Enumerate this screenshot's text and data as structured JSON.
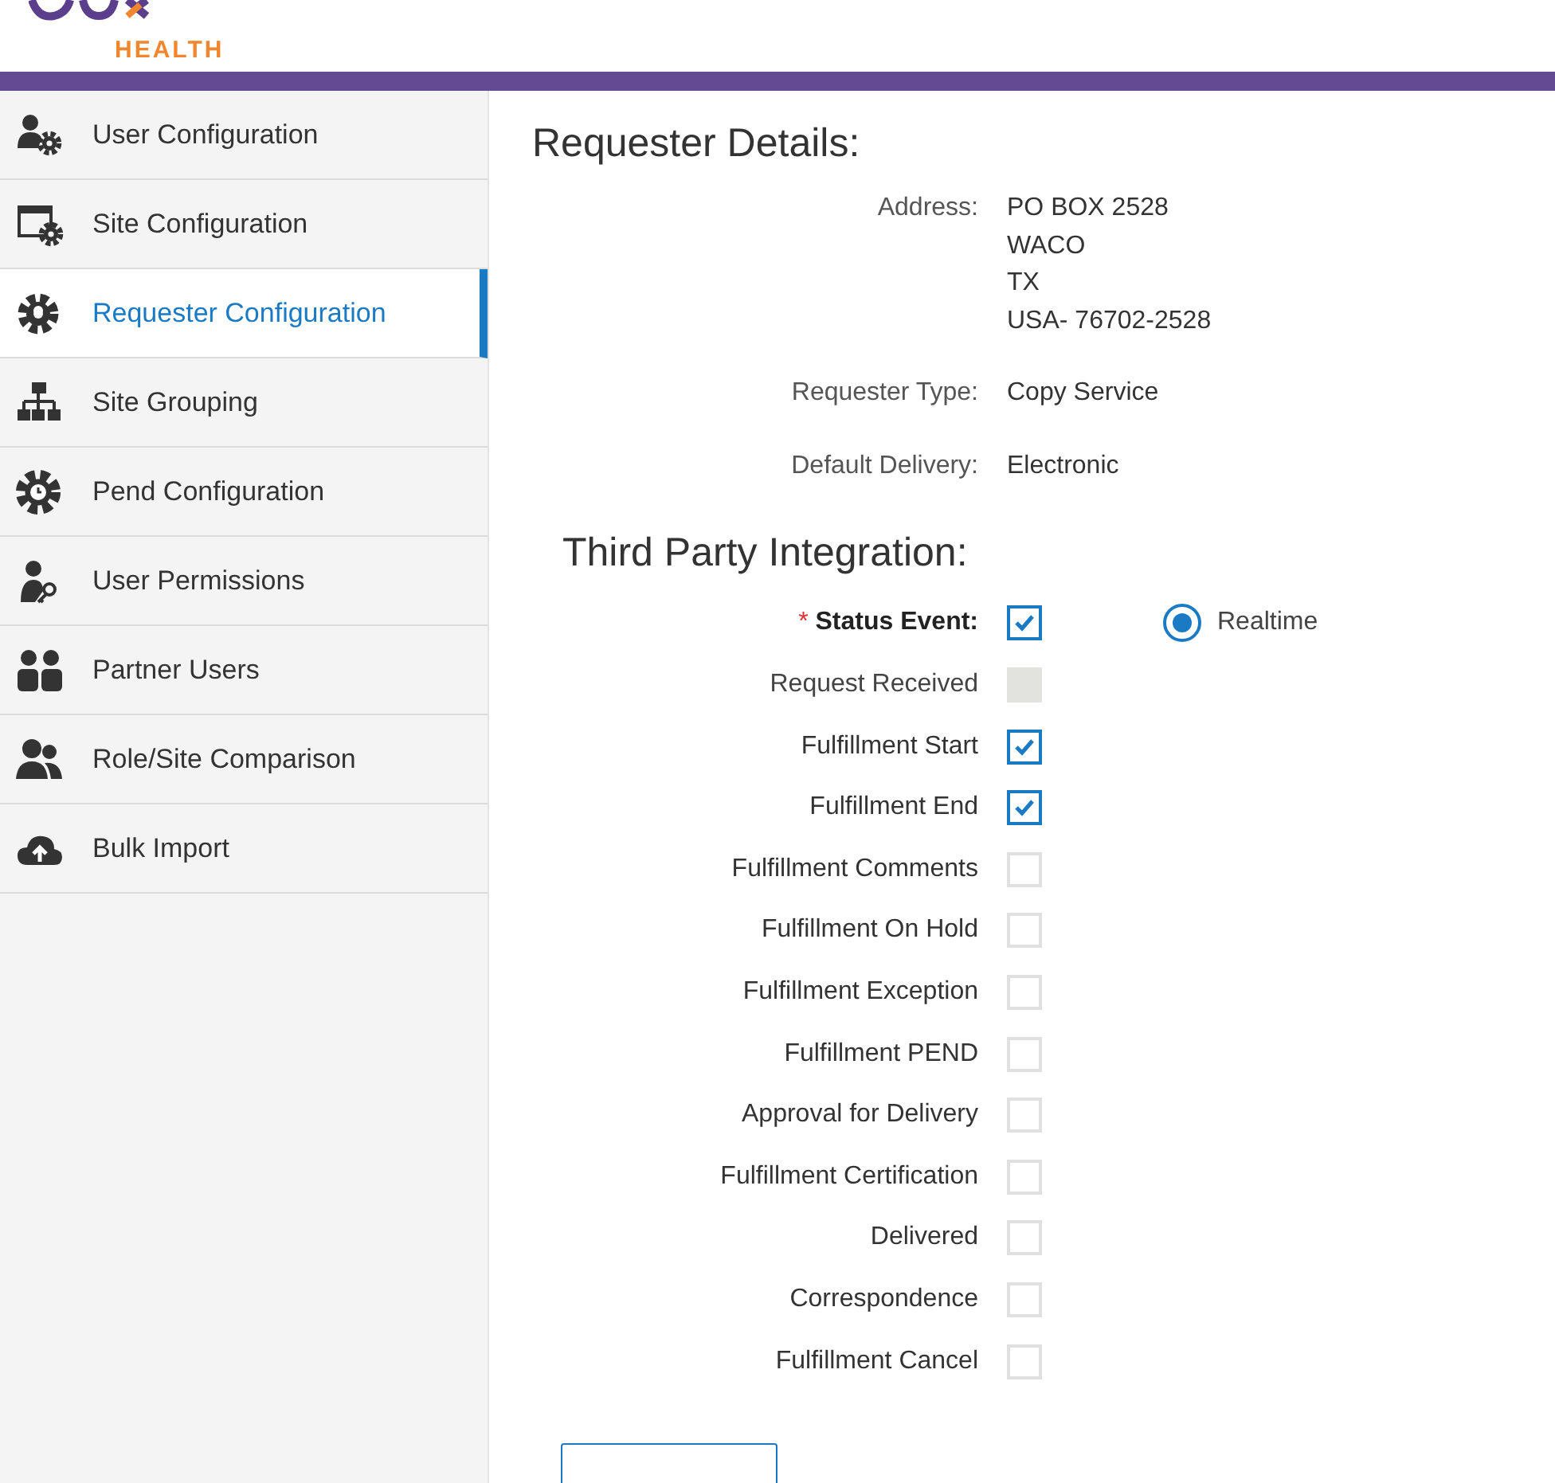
{
  "logo": {
    "text": "HEALTH"
  },
  "sidebar": {
    "items": [
      {
        "label": "User Configuration",
        "kind": "user",
        "selected": false
      },
      {
        "label": "Site Configuration",
        "kind": "site",
        "selected": false
      },
      {
        "label": "Requester Configuration",
        "kind": "requester",
        "selected": true
      },
      {
        "label": "Site Grouping",
        "kind": "grouping",
        "selected": false
      },
      {
        "label": "Pend Configuration",
        "kind": "pend",
        "selected": false
      },
      {
        "label": "User Permissions",
        "kind": "permissions",
        "selected": false
      },
      {
        "label": "Partner Users",
        "kind": "partners",
        "selected": false
      },
      {
        "label": "Role/Site Comparison",
        "kind": "comparison",
        "selected": false
      },
      {
        "label": "Bulk Import",
        "kind": "import",
        "selected": false
      }
    ]
  },
  "requester_details": {
    "title": "Requester Details:",
    "fields": [
      {
        "label": "Address:",
        "lines": [
          "PO BOX 2528",
          "WACO",
          "TX",
          "USA- 76702-2528"
        ]
      },
      {
        "label": "Requester Type:",
        "lines": [
          "Copy Service"
        ]
      },
      {
        "label": "Default Delivery:",
        "lines": [
          "Electronic"
        ]
      }
    ]
  },
  "third_party": {
    "title": "Third Party Integration:",
    "status_event": {
      "required_mark": "*",
      "label": "Status Event:",
      "checked": true,
      "radio": {
        "label": "Realtime",
        "selected": true
      }
    },
    "events": [
      {
        "label": "Request Received",
        "checked": false,
        "disabled": true
      },
      {
        "label": "Fulfillment Start",
        "checked": true,
        "disabled": false
      },
      {
        "label": "Fulfillment End",
        "checked": true,
        "disabled": false
      },
      {
        "label": "Fulfillment Comments",
        "checked": false,
        "disabled": false
      },
      {
        "label": "Fulfillment On Hold",
        "checked": false,
        "disabled": false
      },
      {
        "label": "Fulfillment Exception",
        "checked": false,
        "disabled": false
      },
      {
        "label": "Fulfillment PEND",
        "checked": false,
        "disabled": false
      },
      {
        "label": "Approval for Delivery",
        "checked": false,
        "disabled": false
      },
      {
        "label": "Fulfillment Certification",
        "checked": false,
        "disabled": false
      },
      {
        "label": "Delivered",
        "checked": false,
        "disabled": false
      },
      {
        "label": "Correspondence",
        "checked": false,
        "disabled": false
      },
      {
        "label": "Fulfillment Cancel",
        "checked": false,
        "disabled": false
      }
    ]
  }
}
